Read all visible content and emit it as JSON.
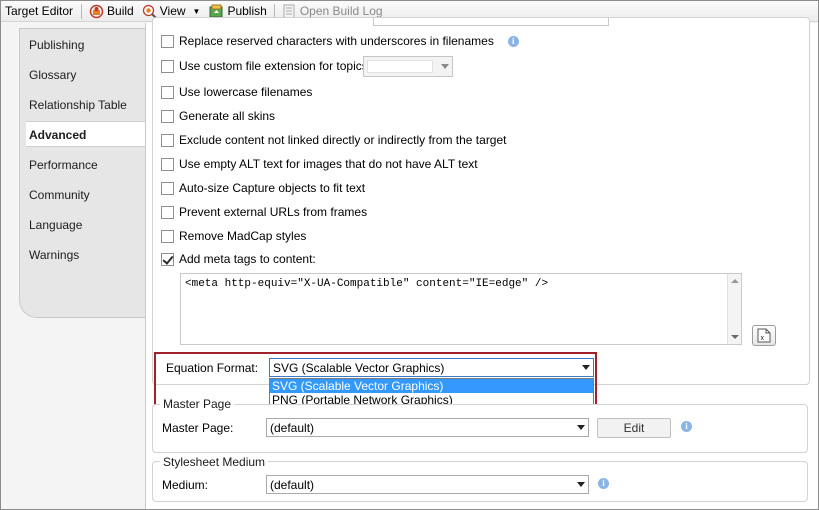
{
  "toolbar": {
    "title": "Target Editor",
    "build": "Build",
    "view": "View",
    "publish": "Publish",
    "open_build_log": "Open Build Log"
  },
  "tabs": [
    {
      "label": "Publishing",
      "active": false
    },
    {
      "label": "Glossary",
      "active": false
    },
    {
      "label": "Relationship Table",
      "active": false
    },
    {
      "label": "Advanced",
      "active": true
    },
    {
      "label": "Performance",
      "active": false
    },
    {
      "label": "Community",
      "active": false
    },
    {
      "label": "Language",
      "active": false
    },
    {
      "label": "Warnings",
      "active": false
    }
  ],
  "options": [
    {
      "label": "Replace reserved characters with underscores in filenames",
      "checked": false
    },
    {
      "label": "Use custom file extension for topics",
      "checked": false
    },
    {
      "label": "Use lowercase filenames",
      "checked": false
    },
    {
      "label": "Generate all skins",
      "checked": false
    },
    {
      "label": "Exclude content not linked directly or indirectly from the target",
      "checked": false
    },
    {
      "label": "Use empty ALT text for images that do not have ALT text",
      "checked": false
    },
    {
      "label": "Auto-size Capture objects to fit text",
      "checked": false
    },
    {
      "label": "Prevent external URLs from frames",
      "checked": false
    },
    {
      "label": "Remove MadCap styles",
      "checked": false
    },
    {
      "label": "Add meta tags to content:",
      "checked": true
    }
  ],
  "meta_tags_text": "<meta http-equiv=\"X-UA-Compatible\" content=\"IE=edge\" />",
  "equation": {
    "label": "Equation Format:",
    "selected": "SVG (Scalable Vector Graphics)",
    "options": [
      "SVG (Scalable Vector Graphics)",
      "PNG (Portable Network Graphics)"
    ]
  },
  "master_page": {
    "group_title": "Master Page",
    "label": "Master Page:",
    "value": "(default)",
    "edit_label": "Edit"
  },
  "stylesheet": {
    "group_title": "Stylesheet Medium",
    "label": "Medium:",
    "value": "(default)"
  },
  "colors": {
    "highlight_border": "#a0222c",
    "selection": "#3399ff",
    "info": "#8ab4e6"
  }
}
